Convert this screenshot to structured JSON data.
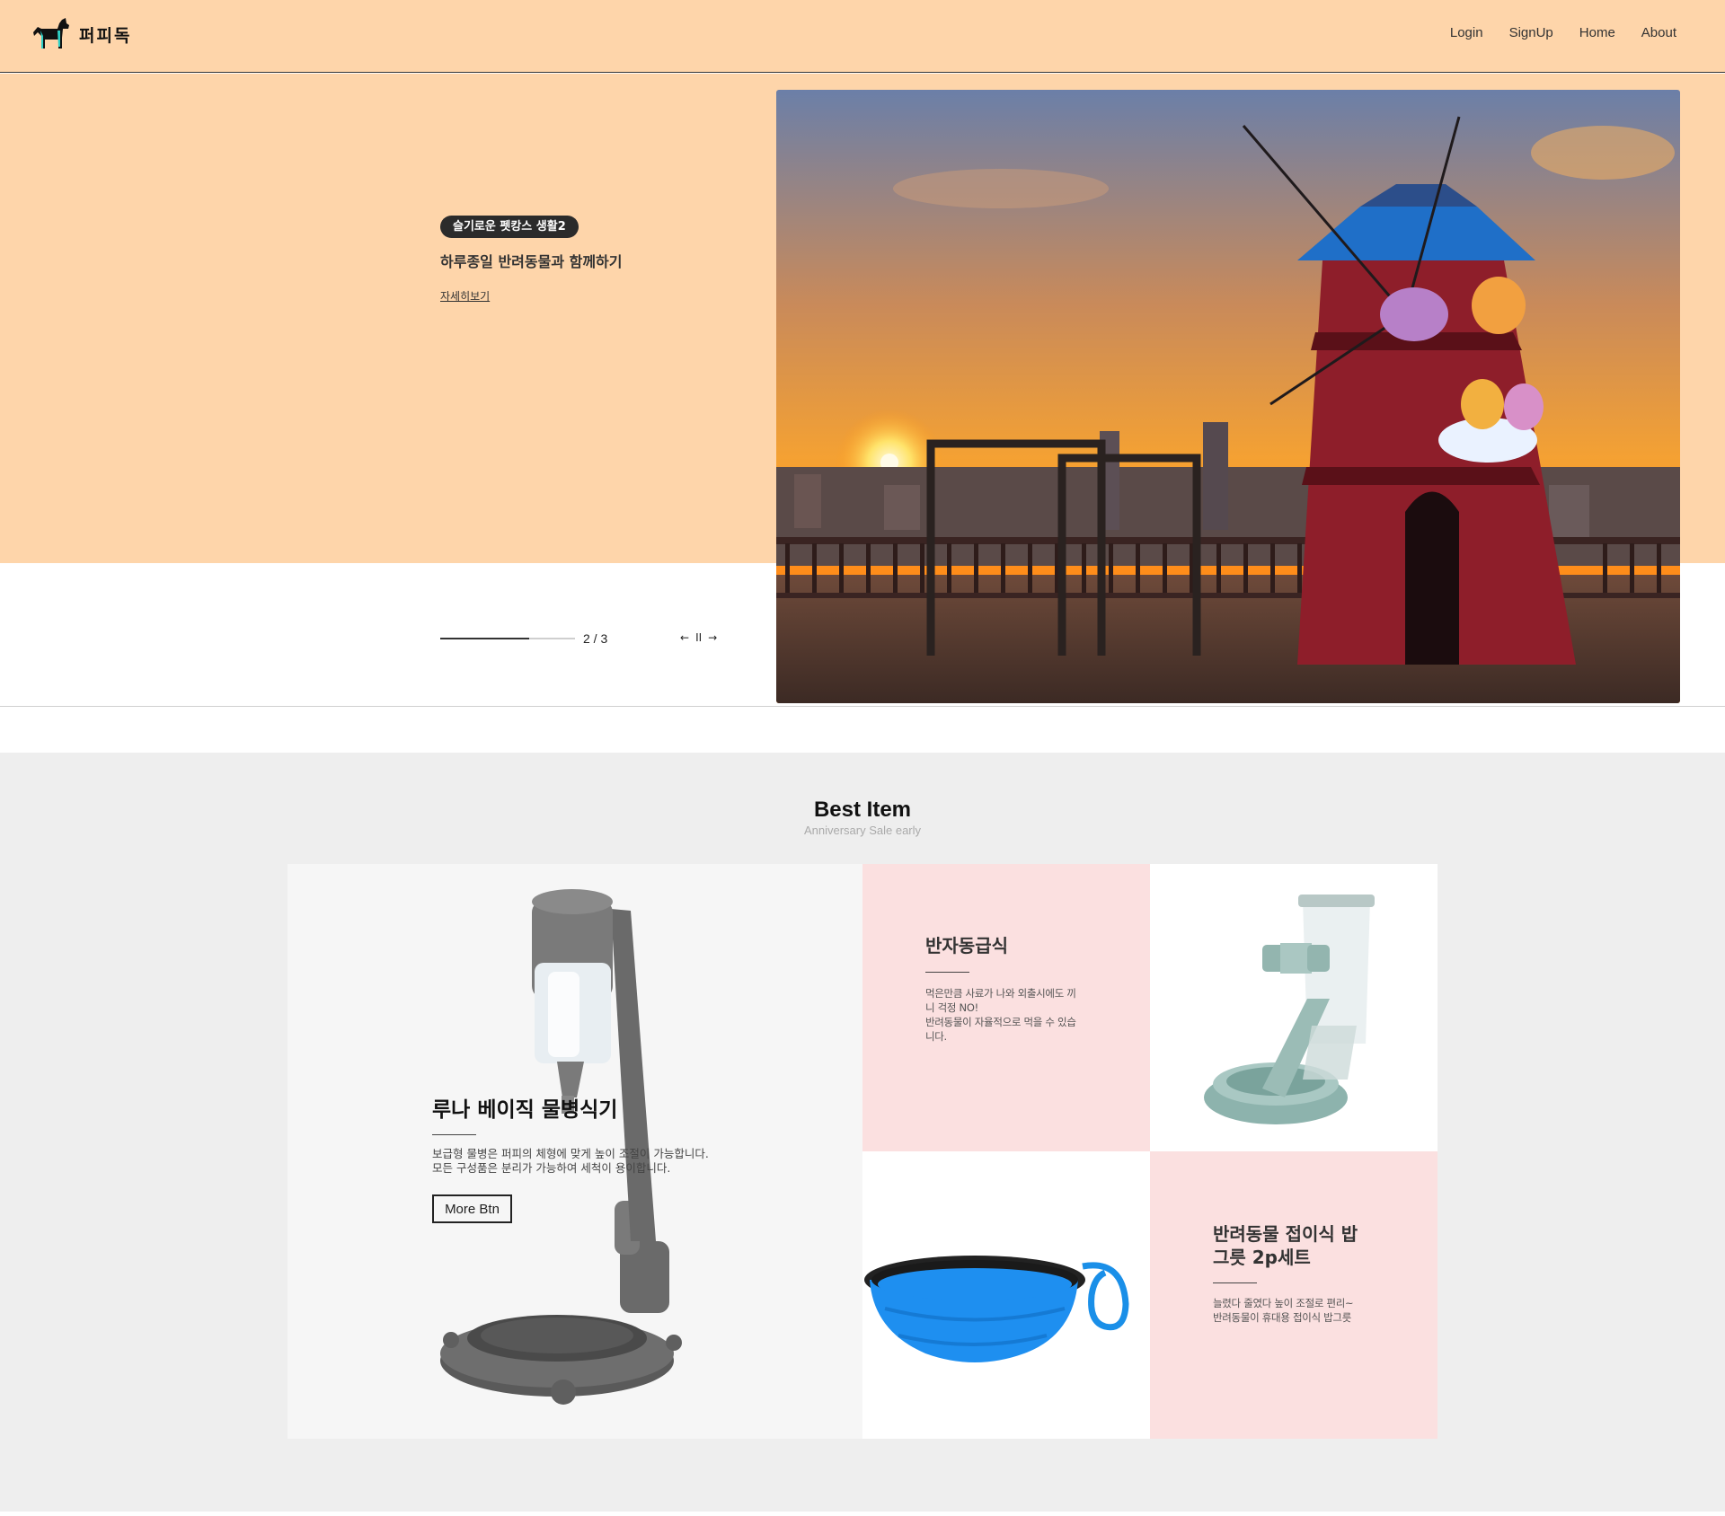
{
  "header": {
    "logo_text": "퍼피독",
    "nav": [
      "Login",
      "SignUp",
      "Home",
      "About"
    ]
  },
  "hero": {
    "badge": "슬기로운 펫캉스 생활2",
    "title": "하루종일 반려동물과 함께하기",
    "link": "자세히보기",
    "counter": "2 / 3",
    "progress": 0.66,
    "controls": {
      "prev": "←",
      "pause": "II",
      "next": "→"
    }
  },
  "best": {
    "title": "Best Item",
    "subtitle": "Anniversary Sale early",
    "featured": {
      "title": "루나 베이직 물병식기",
      "desc_line1": "보급형 물병은 퍼피의 체형에 맞게 높이 조절이 가능합니다.",
      "desc_line2": "모든 구성품은 분리가 가능하여 세척이 용이합니다.",
      "button": "More Btn"
    },
    "item1": {
      "title": "반자동급식",
      "desc_line1": "먹은만큼 사료가 나와 외출시에도 끼",
      "desc_line2": "니 걱정 NO!",
      "desc_line3": "반려동물이 자율적으로 먹을 수 있습",
      "desc_line4": "니다."
    },
    "item2": {
      "title_line1": "반려동물 접이식 밥",
      "title_line2": "그릇 2p세트",
      "desc_line1": "늘렸다 줄였다 높이 조절로 편리~",
      "desc_line2": "반려동물이 휴대용 접이식 밥그릇"
    }
  },
  "colors": {
    "header_bg": "#fed5aa",
    "pink_card": "#fbe0e0",
    "section_bg": "#eeeeee",
    "bowl_blue": "#1e8ff0"
  }
}
